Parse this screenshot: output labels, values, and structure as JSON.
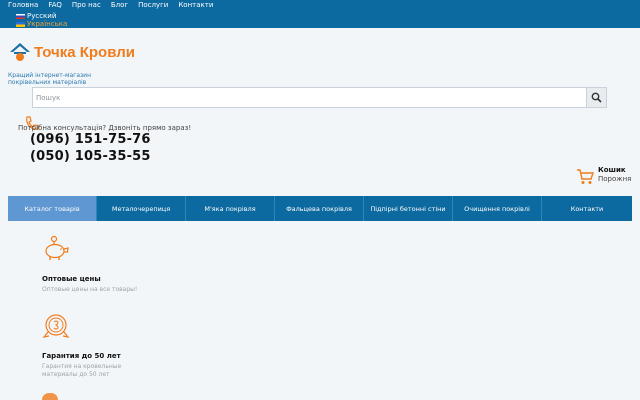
{
  "topnav": {
    "links": [
      "Головна",
      "FAQ",
      "Про нас",
      "Блог",
      "Послуги",
      "Контакти"
    ]
  },
  "languages": [
    "Русский",
    "Українська"
  ],
  "brand": {
    "name": "Точка Кровли",
    "tagline_line1": "Кращий інтернет-магазин",
    "tagline_line2": "покрівельних матеріалів",
    "accent_color": "#f07c1c",
    "primary_color": "#0d6aa0"
  },
  "search": {
    "placeholder": "Пошук",
    "value": ""
  },
  "contacts": {
    "consult_text": "Потрібна консультація? Дзвоніть прямо зараз!",
    "phone1": "(096) 151-75-76",
    "phone2": "(050) 105-35-55"
  },
  "cart": {
    "title": "Кошик",
    "status": "Порожня"
  },
  "mainnav": {
    "items": [
      "Каталог товарів",
      "Металочерепиця",
      "М'яка покрівля",
      "Фальцева покрівля",
      "Підпірні бетонні стіни",
      "Очищення покрівлі",
      "Контакти"
    ],
    "active_index": 0
  },
  "features": [
    {
      "icon": "piggy-bank-icon",
      "title": "Оптовые цены",
      "desc_line1": "Оптовые цены на все товары!",
      "desc_line2": ""
    },
    {
      "icon": "guarantee-medal-icon",
      "title": "Гарантия до 50 лет",
      "desc_line1": "Гарантия на кровельные",
      "desc_line2": "материалы до 50 лет"
    }
  ]
}
